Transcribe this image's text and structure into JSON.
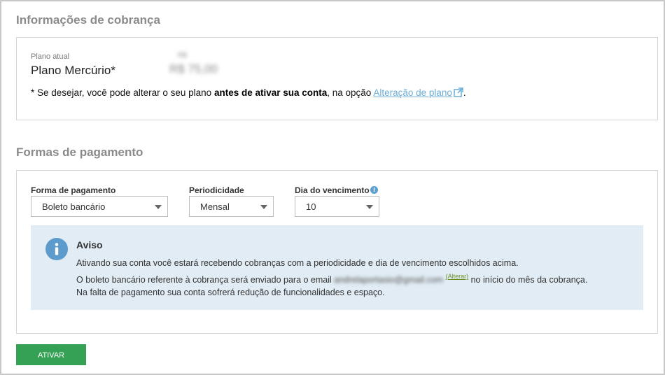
{
  "billing": {
    "title": "Informações de cobrança",
    "current_plan_label": "Plano atual",
    "current_plan_name": "Plano Mercúrio*",
    "price_small": "R$",
    "price_value": "R$ 75,00",
    "note_prefix": "* Se desejar, você pode alterar o seu plano ",
    "note_bold": "antes de ativar sua conta",
    "note_middle": ", na opção ",
    "note_link": "Alteração de plano",
    "note_suffix": "."
  },
  "payment": {
    "title": "Formas de pagamento",
    "method_label": "Forma de pagamento",
    "method_value": "Boleto bancário",
    "period_label": "Periodicidade",
    "period_value": "Mensal",
    "due_label": "Dia do vencimento",
    "due_value": "10",
    "info_glyph": "i"
  },
  "notice": {
    "title": "Aviso",
    "line1": "Ativando sua conta você estará recebendo cobranças com a periodicidade e dia de vencimento escolhidos acima.",
    "line2_prefix": "O boleto bancário referente à cobrança será enviado para o email ",
    "email": "andrelaportasio@gmail.com",
    "change_link": "(Alterar)",
    "line2_suffix": " no início do mês da cobrança.",
    "line3": "Na falta de pagamento sua conta sofrerá redução de funcionalidades e espaço."
  },
  "actions": {
    "activate_label": "ATIVAR",
    "accent_color": "#34a154"
  },
  "icons": {
    "external": "external-link-icon",
    "info": "info-icon",
    "caret": "chevron-down-icon"
  }
}
